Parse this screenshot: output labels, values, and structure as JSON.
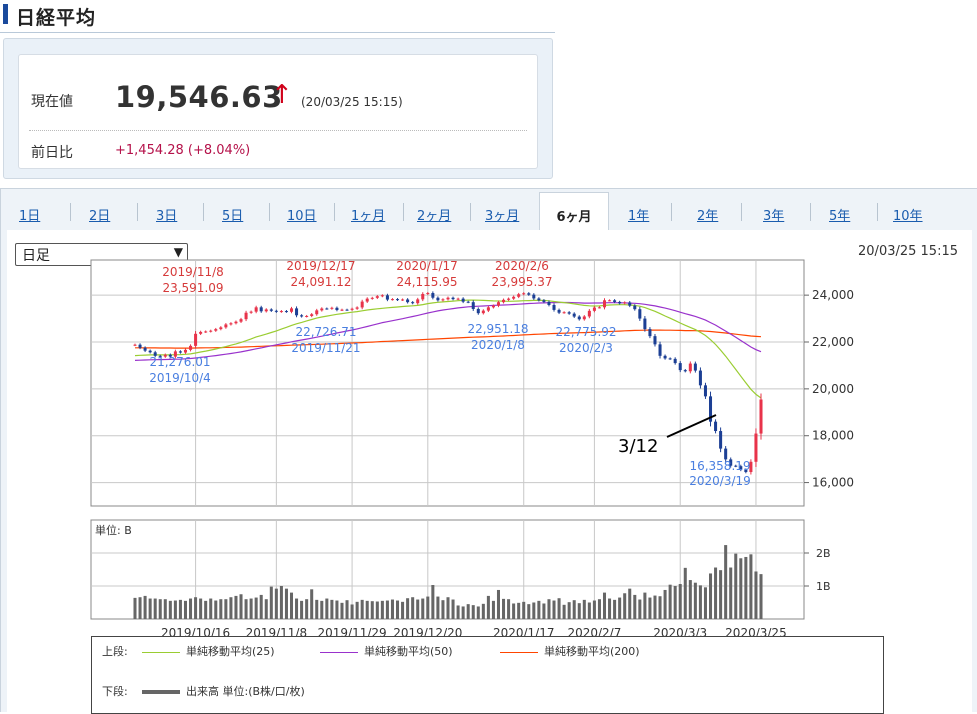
{
  "page": {
    "title": "日経平均"
  },
  "quote": {
    "price_label": "現在値",
    "price": "19,546.63",
    "arrow": "↑",
    "time": "(20/03/25 15:15)",
    "change_label": "前日比",
    "change": "+1,454.28 (+8.04%)"
  },
  "tabs": [
    {
      "label": "1日",
      "active": false
    },
    {
      "label": "2日",
      "active": false
    },
    {
      "label": "3日",
      "active": false
    },
    {
      "label": "5日",
      "active": false
    },
    {
      "label": "10日",
      "active": false
    },
    {
      "label": "1ヶ月",
      "active": false
    },
    {
      "label": "2ヶ月",
      "active": false
    },
    {
      "label": "3ヶ月",
      "active": false
    },
    {
      "label": "6ヶ月",
      "active": true
    },
    {
      "label": "1年",
      "active": false
    },
    {
      "label": "2年",
      "active": false
    },
    {
      "label": "3年",
      "active": false
    },
    {
      "label": "5年",
      "active": false
    },
    {
      "label": "10年",
      "active": false
    }
  ],
  "chart_controls": {
    "period_select": "日足",
    "timestamp": "20/03/25 15:15"
  },
  "chart_data": {
    "type": "candlestick",
    "x_start_date": "2019/9/30",
    "price_ylim": [
      15000,
      25500
    ],
    "price_yticks": [
      16000,
      18000,
      20000,
      22000,
      24000
    ],
    "price_ytick_labels": [
      "16,000",
      "18,000",
      "20,000",
      "22,000",
      "24,000"
    ],
    "xtick_labels": [
      "2019/10/16",
      "2019/11/8",
      "2019/11/29",
      "2019/12/20",
      "2020/1/17",
      "2020/2/7",
      "2020/3/3",
      "2020/3/25"
    ],
    "xtick_index": [
      12,
      28,
      43,
      58,
      77,
      91,
      108,
      123
    ],
    "close": [
      21885,
      21755,
      21630,
      21560,
      21410,
      21375,
      21456,
      21375,
      21600,
      21550,
      21665,
      21835,
      22350,
      22430,
      22450,
      22482,
      22550,
      22625,
      22750,
      22800,
      22867,
      22974,
      23250,
      23295,
      23480,
      23310,
      23390,
      23331,
      23290,
      23320,
      23290,
      23435,
      23140,
      23090,
      23111,
      23185,
      23350,
      23430,
      23420,
      23460,
      23365,
      23380,
      23375,
      23420,
      23475,
      23725,
      23850,
      23885,
      23956,
      23992,
      23810,
      23830,
      23795,
      23815,
      23700,
      23656,
      23820,
      24050,
      24090,
      23890,
      23780,
      23820,
      23890,
      23830,
      23850,
      23720,
      23700,
      23410,
      23230,
      23340,
      23480,
      23550,
      23700,
      23800,
      23850,
      23930,
      24040,
      24080,
      24020,
      23860,
      23780,
      23710,
      23580,
      23370,
      23250,
      23270,
      23210,
      23085,
      22970,
      23090,
      23330,
      23470,
      23480,
      23780,
      23780,
      23710,
      23650,
      23690,
      23550,
      23400,
      23000,
      22550,
      22250,
      21900,
      21410,
      21300,
      21280,
      21100,
      20800,
      20750,
      21080,
      20780,
      20150,
      19680,
      18600,
      18200,
      17450,
      16990,
      16720,
      16700,
      16550,
      16450,
      16887,
      18092,
      19546
    ],
    "candle_color_up": "#e8334a",
    "candle_color_down": "#1c3f94",
    "ma25_color": "#9acd32",
    "ma50_color": "#9932cc",
    "ma200_color": "#ff4500",
    "annotations_high": [
      {
        "date": "2019/11/8",
        "value": "23,591.09"
      },
      {
        "date": "2019/12/17",
        "value": "24,091.12"
      },
      {
        "date": "2020/1/17",
        "value": "24,115.95"
      },
      {
        "date": "2020/2/6",
        "value": "23,995.37"
      }
    ],
    "annotations_low": [
      {
        "date": "2019/10/4",
        "value": "21,276.01"
      },
      {
        "date": "2019/11/21",
        "value": "22,726.71"
      },
      {
        "date": "2020/1/8",
        "value": "22,951.18"
      },
      {
        "date": "2020/2/3",
        "value": "22,775.92"
      },
      {
        "date": "2020/3/19",
        "value": "16,358.19"
      }
    ],
    "callout_label": "3/12",
    "volume_unit_label": "単位: B",
    "volume_ylim": [
      0,
      3
    ],
    "volume_yticks": [
      1,
      2
    ],
    "volume_ytick_labels": [
      "1B",
      "2B"
    ],
    "volume_color": "#666666",
    "volume": [
      0.64,
      0.66,
      0.7,
      0.62,
      0.62,
      0.6,
      0.6,
      0.55,
      0.56,
      0.58,
      0.55,
      0.62,
      0.66,
      0.62,
      0.55,
      0.62,
      0.56,
      0.6,
      0.6,
      0.66,
      0.7,
      0.75,
      0.6,
      0.62,
      0.65,
      0.73,
      0.6,
      0.98,
      0.92,
      1.0,
      0.92,
      0.8,
      0.62,
      0.55,
      0.6,
      0.9,
      0.58,
      0.55,
      0.62,
      0.58,
      0.56,
      0.49,
      0.57,
      0.44,
      0.52,
      0.58,
      0.55,
      0.54,
      0.53,
      0.55,
      0.56,
      0.59,
      0.56,
      0.52,
      0.63,
      0.66,
      0.59,
      0.62,
      0.68,
      1.03,
      0.68,
      0.57,
      0.66,
      0.59,
      0.41,
      0.38,
      0.45,
      0.42,
      0.38,
      0.46,
      0.7,
      0.55,
      0.88,
      0.61,
      0.6,
      0.47,
      0.49,
      0.52,
      0.45,
      0.5,
      0.55,
      0.47,
      0.6,
      0.56,
      0.63,
      0.43,
      0.51,
      0.57,
      0.48,
      0.58,
      0.5,
      0.56,
      0.6,
      0.8,
      0.62,
      0.58,
      0.65,
      0.78,
      0.92,
      0.73,
      0.59,
      0.8,
      0.65,
      0.71,
      0.69,
      0.88,
      1.04,
      1.0,
      1.06,
      1.55,
      1.18,
      1.1,
      1.02,
      0.96,
      1.38,
      1.56,
      1.48,
      2.24,
      1.56,
      1.98,
      1.84,
      1.88,
      1.96,
      1.44,
      1.36
    ],
    "legend": {
      "upper_label": "上段:",
      "lower_label": "下段:",
      "ma25": "単純移動平均(25)",
      "ma50": "単純移動平均(50)",
      "ma200": "単純移動平均(200)",
      "volume": "出来高 単位:(B株/口/枚)"
    }
  }
}
